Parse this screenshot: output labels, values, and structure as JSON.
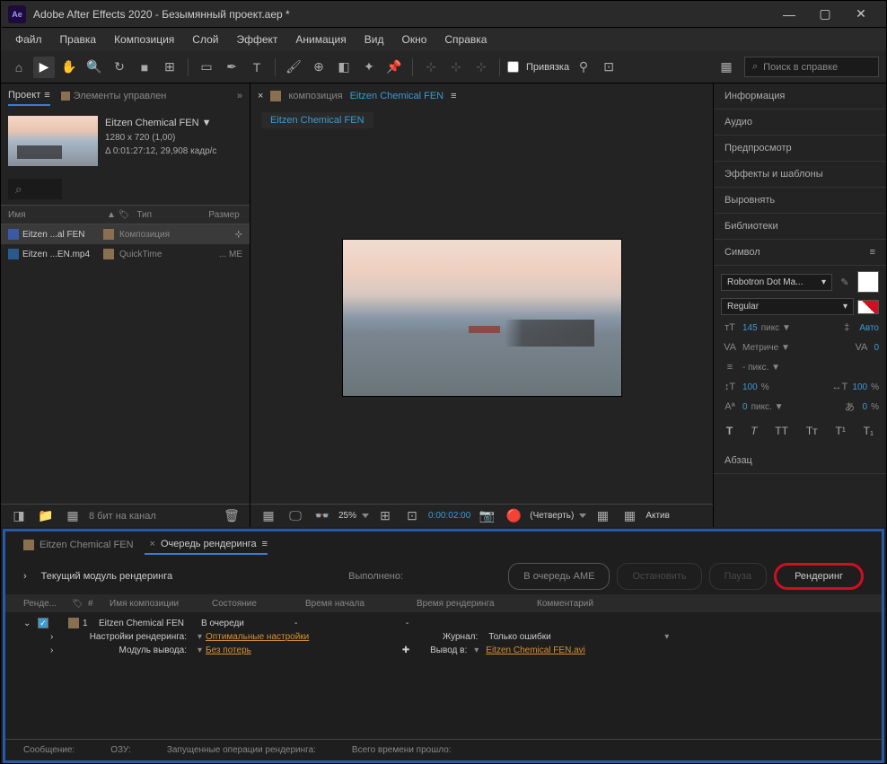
{
  "title": "Adobe After Effects 2020 - Безымянный проект.aep *",
  "app_icon": "Ae",
  "menu": [
    "Файл",
    "Правка",
    "Композиция",
    "Слой",
    "Эффект",
    "Анимация",
    "Вид",
    "Окно",
    "Справка"
  ],
  "toolbar": {
    "snap_label": "Привязка",
    "search_placeholder": "Поиск в справке"
  },
  "project": {
    "tab_project": "Проект",
    "tab_elements": "Элементы управлен",
    "comp_name": "Eitzen Chemical FEN ▼",
    "comp_dims": "1280 x 720 (1,00)",
    "comp_dur": "Δ 0:01:27:12, 29,908 кадр/с",
    "headers": {
      "name": "Имя",
      "type": "Тип",
      "size": "Размер"
    },
    "items": [
      {
        "name": "Eitzen ...al FEN",
        "type": "Композиция",
        "extra": ""
      },
      {
        "name": "Eitzen ...EN.mp4",
        "type": "QuickTime",
        "extra": "... ME"
      }
    ],
    "bpc": "8 бит на канал"
  },
  "comp": {
    "tab_prefix": "композиция",
    "tab_name": "Eitzen Chemical FEN",
    "breadcrumb": "Eitzen Chemical FEN",
    "zoom": "25%",
    "time": "0:00:02:00",
    "quality": "(Четверть)",
    "active": "Актив"
  },
  "right": {
    "sections": [
      "Информация",
      "Аудио",
      "Предпросмотр",
      "Эффекты и шаблоны",
      "Выровнять",
      "Библиотеки"
    ],
    "symbol_label": "Символ",
    "font": "Robotron Dot Ma...",
    "style": "Regular",
    "size": "145",
    "size_unit": "пикс ▼",
    "leading": "Авто",
    "kerning": "Метриче ▼",
    "tracking": "0",
    "stroke": "- пикс. ▼",
    "hscale": "100",
    "hscale_unit": "%",
    "vscale": "100",
    "vscale_unit": "%",
    "baseline": "0",
    "baseline_unit": "пикс. ▼",
    "tsume": "0",
    "tsume_unit": "%",
    "paragraph_label": "Абзац"
  },
  "queue": {
    "tab1": "Eitzen Chemical FEN",
    "tab2": "Очередь рендеринга",
    "current_label": "Текущий модуль рендеринга",
    "done_label": "Выполнено:",
    "btn_ame": "В очередь AME",
    "btn_stop": "Остановить",
    "btn_pause": "Пауза",
    "btn_render": "Рендеринг",
    "headers": [
      "Ренде...",
      "#",
      "Имя композиции",
      "Состояние",
      "Время начала",
      "Время рендеринга",
      "Комментарий"
    ],
    "row": {
      "num": "1",
      "name": "Eitzen Chemical FEN",
      "state": "В очереди"
    },
    "settings_label": "Настройки рендеринга:",
    "settings_val": "Оптимальные настройки",
    "journal_label": "Журнал:",
    "journal_val": "Только ошибки",
    "output_module_label": "Модуль вывода:",
    "output_module_val": "Без потерь",
    "output_to_label": "Вывод в:",
    "output_to_val": "Eitzen Chemical FEN.avi",
    "footer": {
      "msg": "Сообщение:",
      "ram": "ОЗУ:",
      "ops": "Запущенные операции рендеринга:",
      "elapsed": "Всего времени прошло:"
    }
  }
}
